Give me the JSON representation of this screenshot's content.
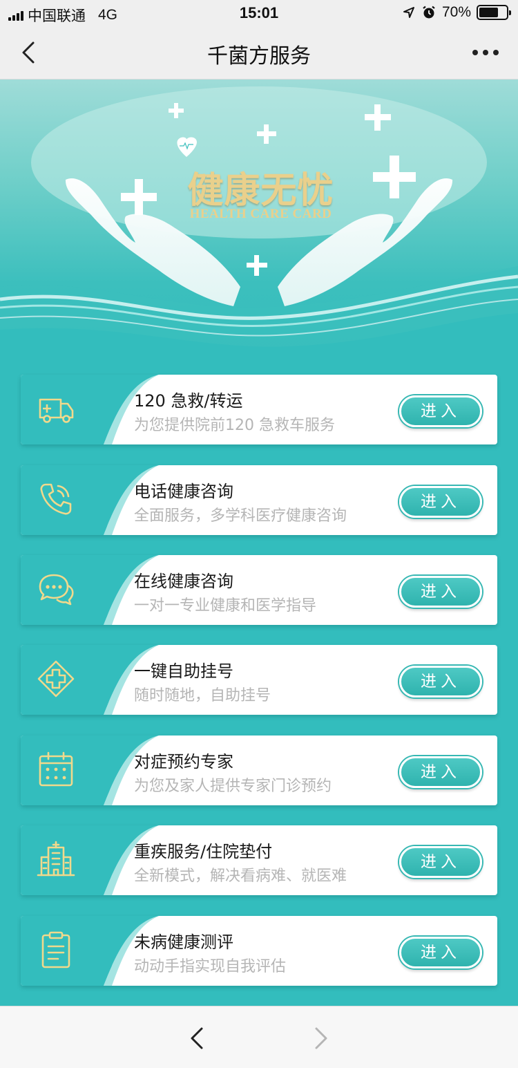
{
  "status_bar": {
    "carrier": "中国联通",
    "network": "4G",
    "time": "15:01",
    "battery": "70%",
    "battery_level": 0.7
  },
  "nav": {
    "title": "千菌方服务",
    "back_icon": "chevron-left-icon",
    "more_icon": "more-dots-icon"
  },
  "banner": {
    "title": "健康无忧",
    "subtitle": "HEALTH CARE CARD"
  },
  "services": [
    {
      "title": "120 急救/转运",
      "desc": "为您提供院前120 急救车服务",
      "button": "进入",
      "icon": "ambulance-icon"
    },
    {
      "title": "电话健康咨询",
      "desc": "全面服务，多学科医疗健康咨询",
      "button": "进入",
      "icon": "phone-call-icon"
    },
    {
      "title": "在线健康咨询",
      "desc": "一对一专业健康和医学指导",
      "button": "进入",
      "icon": "chat-bubble-icon"
    },
    {
      "title": "一键自助挂号",
      "desc": "随时随地，自助挂号",
      "button": "进入",
      "icon": "medical-cross-icon"
    },
    {
      "title": "对症预约专家",
      "desc": "为您及家人提供专家门诊预约",
      "button": "进入",
      "icon": "calendar-icon"
    },
    {
      "title": "重疾服务/住院垫付",
      "desc": "全新模式，解决看病难、就医难",
      "button": "进入",
      "icon": "hospital-icon"
    },
    {
      "title": "未病健康测评",
      "desc": "动动手指实现自我评估",
      "button": "进入",
      "icon": "clipboard-icon"
    }
  ],
  "colors": {
    "accent": "#33bdbd",
    "button": "#2fb3ae",
    "icon_gold": "#f1d98c"
  }
}
